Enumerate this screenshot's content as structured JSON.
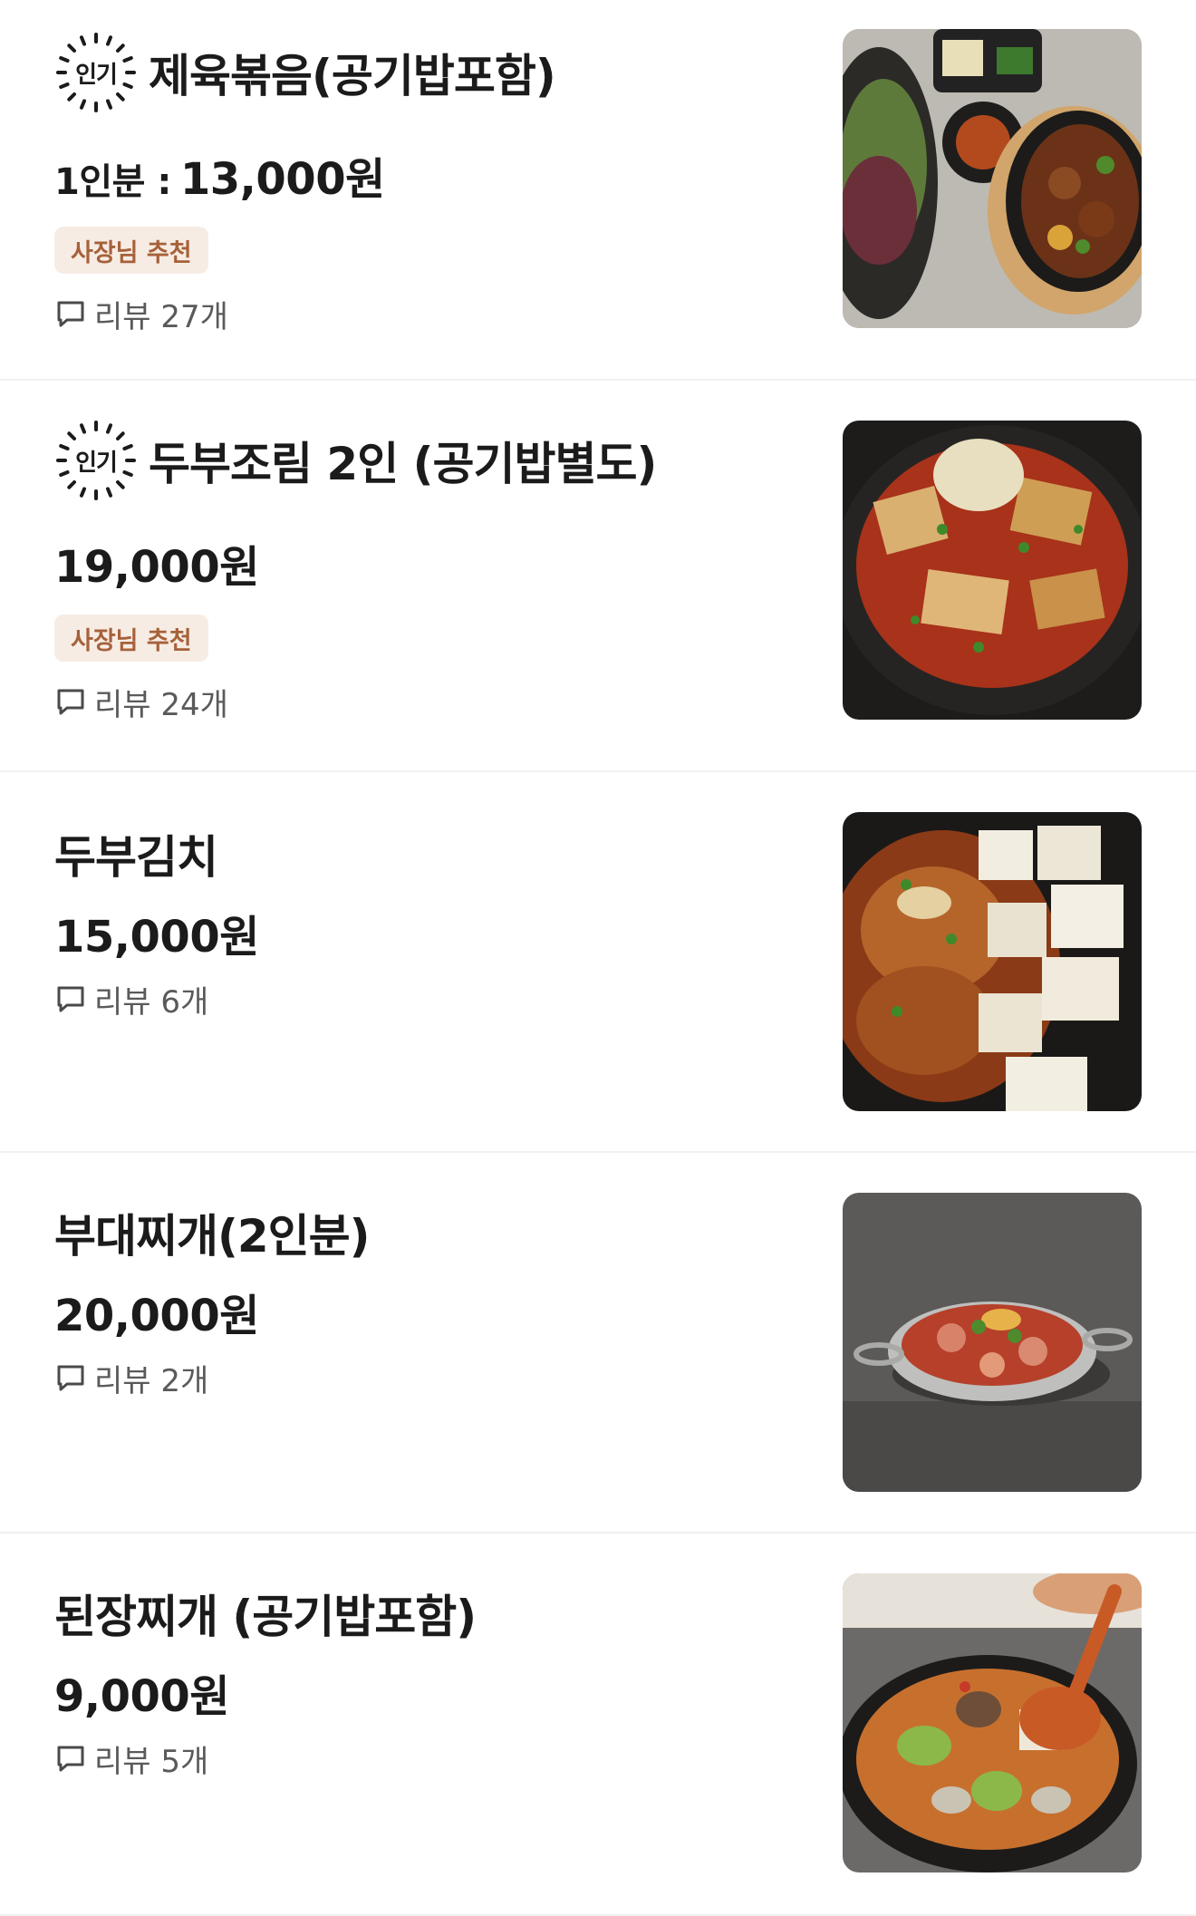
{
  "popular_label": "인기",
  "owner_tag_label": "사장님 추천",
  "review_prefix": "리뷰",
  "items": [
    {
      "title": "제육볶음(공기밥포함)",
      "popular": true,
      "price_prefix": "1인분 :",
      "price": "13,000원",
      "owner_recommended": true,
      "reviews": "27개",
      "image_icon": "jeyuk-bokkeum-photo"
    },
    {
      "title": "두부조림 2인 (공기밥별도)",
      "popular": true,
      "price": "19,000원",
      "owner_recommended": true,
      "reviews": "24개",
      "image_icon": "dubu-jorim-photo"
    },
    {
      "title": "두부김치",
      "popular": false,
      "price": "15,000원",
      "owner_recommended": false,
      "reviews": "6개",
      "image_icon": "dubu-kimchi-photo"
    },
    {
      "title": "부대찌개(2인분)",
      "popular": false,
      "price": "20,000원",
      "owner_recommended": false,
      "reviews": "2개",
      "image_icon": "budae-jjigae-photo"
    },
    {
      "title": "된장찌개 (공기밥포함)",
      "popular": false,
      "price": "9,000원",
      "owner_recommended": false,
      "reviews": "5개",
      "image_icon": "doenjang-jjigae-photo"
    }
  ],
  "colors": {
    "owner_tag_bg": "#f7ece4",
    "owner_tag_text": "#a6613a",
    "divider": "#f0f0f0",
    "review_text": "#5a5a5a"
  }
}
